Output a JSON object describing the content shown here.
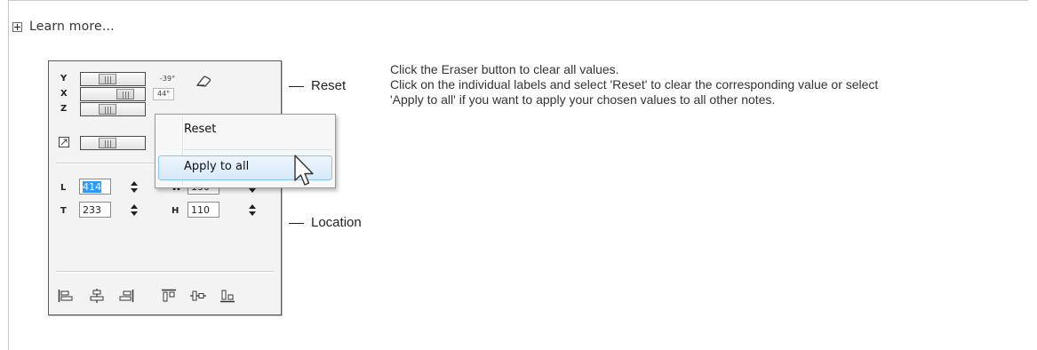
{
  "learn_more": {
    "label": "Learn more..."
  },
  "panel": {
    "rotation": {
      "y_label": "Y",
      "x_label": "X",
      "z_label": "Z",
      "y_value": "-39°",
      "x_value": "44°"
    },
    "position": {
      "l_label": "L",
      "l_value": "414",
      "t_label": "T",
      "t_value": "233",
      "w_label": "W",
      "w_value": "130",
      "h_label": "H",
      "h_value": "110"
    },
    "icons": {
      "eraser": "eraser-icon",
      "zoom": "expand-icon",
      "align": [
        "align-left-icon",
        "align-center-icon",
        "align-right-icon",
        "align-top-icon",
        "align-middle-icon",
        "align-bottom-icon"
      ]
    }
  },
  "context_menu": {
    "reset_label": "Reset",
    "apply_all_label": "Apply to all"
  },
  "callouts": {
    "reset": "Reset",
    "location": "Location"
  },
  "description": {
    "line1": "Click the Eraser button to clear all values.",
    "line2": "Click on the individual labels and select 'Reset' to clear the corresponding value or select",
    "line3": "'Apply to all' if you want to apply your chosen values to all other notes."
  },
  "colors": {
    "selection": "#3399ff",
    "menu_highlight": "#d6e9fa"
  }
}
